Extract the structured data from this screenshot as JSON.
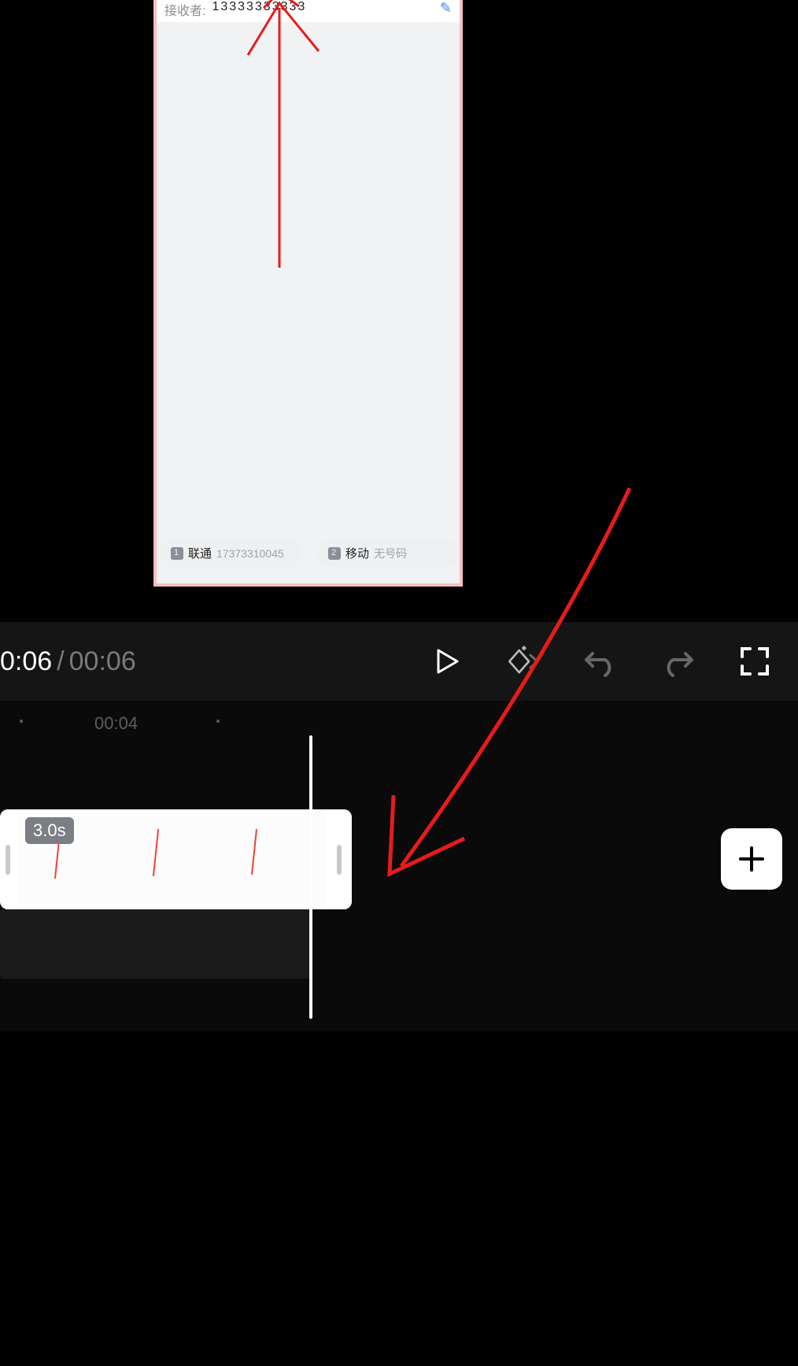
{
  "preview": {
    "header_label": "接收者:",
    "header_value": "13333333333",
    "chips": [
      {
        "carrier": "联通",
        "number": "17373310045"
      },
      {
        "carrier": "移动",
        "number": "无号码"
      }
    ]
  },
  "controls": {
    "current_time": "0:06",
    "separator": "/",
    "total_time": "00:06"
  },
  "timeline": {
    "ruler_label": "00:04",
    "clip_duration": "3.0s"
  }
}
